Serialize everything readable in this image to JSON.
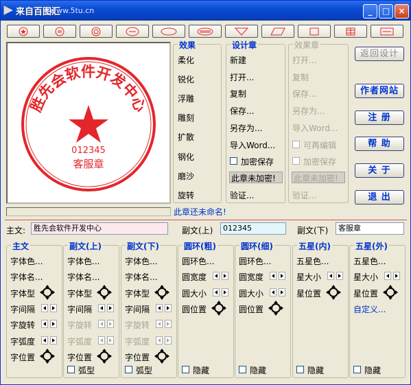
{
  "window": {
    "title": "来自百图汇",
    "site": "www.5tu.cn"
  },
  "stamp": {
    "company": "胜先会软件开发中心",
    "number": "012345",
    "bottom": "客服章",
    "color": "#e3262b"
  },
  "effects": {
    "title": "效果",
    "items": [
      "柔化",
      "锐化",
      "浮雕",
      "雕刻",
      "扩散",
      "钢化",
      "磨沙",
      "旋转"
    ]
  },
  "design": {
    "title": "设计章",
    "items": [
      "新建",
      "打开...",
      "复制",
      "保存...",
      "另存为...",
      "导入Word..."
    ],
    "encrypt": "加密保存",
    "status": "此章未加密!",
    "verify": "验证..."
  },
  "effstamp": {
    "title": "效果章",
    "items": [
      "打开...",
      "复制",
      "保存...",
      "另存为...",
      "导入Word..."
    ],
    "reedit": "可再编辑",
    "encrypt": "加密保存",
    "status": "此章未加密!",
    "verify": "验证..."
  },
  "rightbuttons": {
    "back": "返回设计",
    "author": "作者网站",
    "register": "注 册",
    "help": "帮 助",
    "about": "关 于",
    "exit": "退 出"
  },
  "unnamed": "此章还未命名!",
  "fields": {
    "main_label": "主文:",
    "main_value": "胜先会软件开发中心",
    "sub_up_label": "副文(上)",
    "sub_up_value": "012345",
    "sub_down_label": "副文(下)",
    "sub_down_value": "客服章"
  },
  "panels": {
    "main": {
      "title": "主文",
      "items": [
        "字体色...",
        "字体名...",
        "字体型",
        "字间隔",
        "字旋转",
        "字弧度",
        "字位置"
      ]
    },
    "subup": {
      "title": "副文(上)",
      "items": [
        "字体色...",
        "字体名...",
        "字体型",
        "字间隔",
        "字旋转",
        "字弧度",
        "字位置"
      ],
      "arc": "弧型"
    },
    "subdown": {
      "title": "副文(下)",
      "items": [
        "字体色...",
        "字体名...",
        "字体型",
        "字间隔",
        "字旋转",
        "字弧度",
        "字位置"
      ],
      "arc": "弧型"
    },
    "ringthick": {
      "title": "圆环(粗)",
      "items": [
        "圆环色...",
        "圆宽度",
        "圆大小",
        "圆位置"
      ],
      "hide": "隐藏"
    },
    "ringthin": {
      "title": "圆环(细)",
      "items": [
        "圆环色...",
        "圆宽度",
        "圆大小",
        "圆位置"
      ],
      "hide": "隐藏"
    },
    "starin": {
      "title": "五星(内)",
      "items": [
        "五星色...",
        "星大小",
        "星位置"
      ],
      "hide": "隐藏"
    },
    "starout": {
      "title": "五星(外)",
      "items": [
        "五星色...",
        "星大小",
        "星位置"
      ],
      "custom": "自定义...",
      "hide": "隐藏"
    }
  }
}
